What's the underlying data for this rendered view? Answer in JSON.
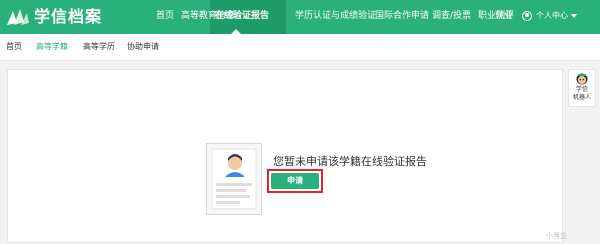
{
  "brand": {
    "name": "学信档案",
    "color": "#2ab07a"
  },
  "nav": {
    "items": [
      {
        "label": "首页"
      },
      {
        "label": "高等教育信息"
      },
      {
        "label": "在线验证报告",
        "active": true
      },
      {
        "label": "学历认证与成绩验证"
      },
      {
        "label": "国际合作申请"
      },
      {
        "label": "调查/投票"
      },
      {
        "label": "职业测评"
      },
      {
        "label": "就业"
      }
    ],
    "user_menu": "个人中心"
  },
  "subnav": {
    "items": [
      {
        "label": "首页"
      },
      {
        "label": "高等学籍",
        "active": true
      },
      {
        "label": "高等学历"
      },
      {
        "label": "协助申请"
      }
    ]
  },
  "main": {
    "message": "您暂未申请该学籍在线验证报告",
    "apply_button": "申请",
    "highlight_color": "#e0262b"
  },
  "robot": {
    "label_line1": "学信",
    "label_line2": "机器人"
  },
  "watermark": "小黑盒"
}
